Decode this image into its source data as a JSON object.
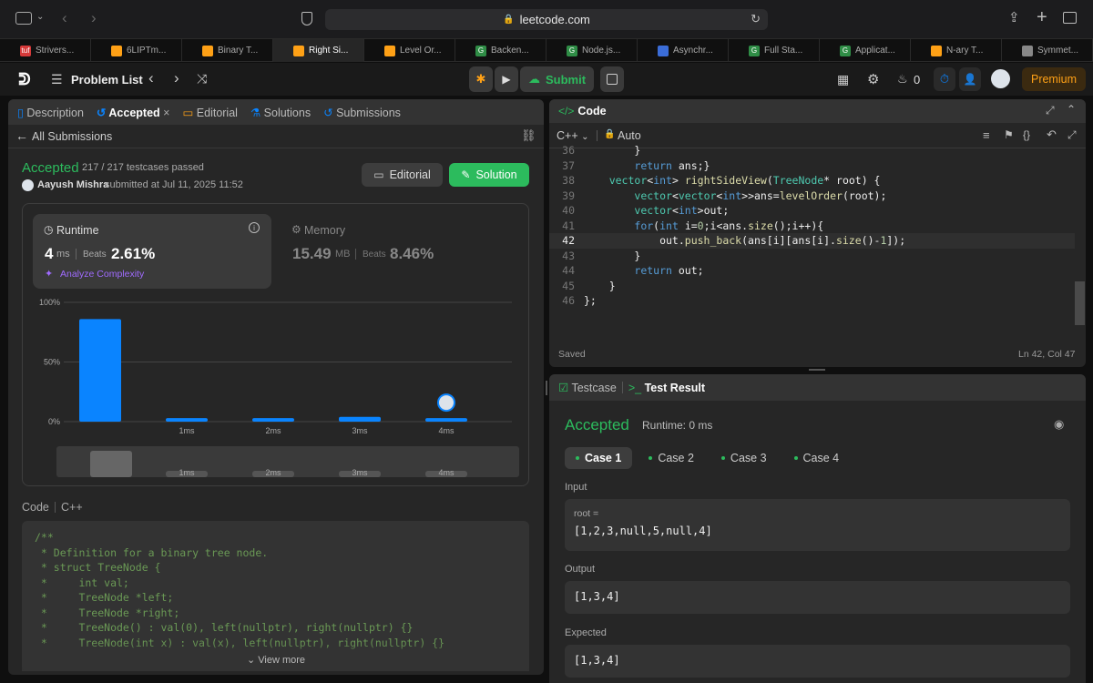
{
  "browser": {
    "url": "leetcode.com",
    "tabs": [
      {
        "label": "Strivers...",
        "fav_color": "#d63a3a",
        "fav_text": "tuf"
      },
      {
        "label": "6LIPTm...",
        "fav_color": "#ffa116",
        "fav_text": ""
      },
      {
        "label": "Binary T...",
        "fav_color": "#ffa116",
        "fav_text": ""
      },
      {
        "label": "Right Si...",
        "fav_color": "#ffa116",
        "fav_text": ""
      },
      {
        "label": "Level Or...",
        "fav_color": "#ffa116",
        "fav_text": ""
      },
      {
        "label": "Backen...",
        "fav_color": "#2f8d46",
        "fav_text": "G"
      },
      {
        "label": "Node.js...",
        "fav_color": "#2f8d46",
        "fav_text": "G"
      },
      {
        "label": "Asynchr...",
        "fav_color": "#3b6dd8",
        "fav_text": ""
      },
      {
        "label": "Full Sta...",
        "fav_color": "#2f8d46",
        "fav_text": "G"
      },
      {
        "label": "Applicat...",
        "fav_color": "#2f8d46",
        "fav_text": "G"
      },
      {
        "label": "N-ary T...",
        "fav_color": "#ffa116",
        "fav_text": ""
      },
      {
        "label": "Symmet...",
        "fav_color": "#888888",
        "fav_text": ""
      }
    ],
    "active_tab_index": 3
  },
  "nav": {
    "problem_list": "Problem List",
    "submit": "Submit",
    "streak": "0",
    "premium": "Premium"
  },
  "left": {
    "tabs": {
      "description": "Description",
      "accepted": "Accepted",
      "editorial": "Editorial",
      "solutions": "Solutions",
      "submissions": "Submissions"
    },
    "all_submissions": "All Submissions",
    "status": "Accepted",
    "testcases": "217 / 217 testcases passed",
    "user": "Aayush Mishra",
    "submitted_at": "submitted at Jul 11, 2025 11:52",
    "editorial_btn": "Editorial",
    "solution_btn": "Solution",
    "runtime": {
      "label": "Runtime",
      "value": "4",
      "unit": "ms",
      "beats_label": "Beats",
      "beats": "2.61%",
      "analyze": "Analyze Complexity"
    },
    "memory": {
      "label": "Memory",
      "value": "15.49",
      "unit": "MB",
      "beats_label": "Beats",
      "beats": "8.46%"
    },
    "code_label": "Code",
    "code_lang": "C++",
    "code_lines": [
      "/**",
      " * Definition for a binary tree node.",
      " * struct TreeNode {",
      " *     int val;",
      " *     TreeNode *left;",
      " *     TreeNode *right;",
      " *     TreeNode() : val(0), left(nullptr), right(nullptr) {}",
      " *     TreeNode(int x) : val(x), left(nullptr), right(nullptr) {}"
    ],
    "view_more": "View more"
  },
  "chart_data": {
    "type": "bar",
    "y_tick_labels": [
      "100%",
      "50%",
      "0%"
    ],
    "categories": [
      "",
      "1ms",
      "2ms",
      "3ms",
      "4ms"
    ],
    "values": [
      86,
      3,
      3,
      4,
      3
    ],
    "ylim": [
      0,
      100
    ],
    "grid": true,
    "bar_color": "#0a84ff",
    "highlight_category": "4ms",
    "navigator_labels": [
      "1ms",
      "2ms",
      "3ms",
      "4ms"
    ]
  },
  "editor": {
    "title": "Code",
    "lang": "C++",
    "mode": "Auto",
    "saved": "Saved",
    "cursor": "Ln 42, Col 47",
    "current_line": 42
  },
  "result": {
    "tabs": {
      "testcase": "Testcase",
      "test_result": "Test Result"
    },
    "status": "Accepted",
    "runtime": "Runtime: 0 ms",
    "cases": [
      "Case 1",
      "Case 2",
      "Case 3",
      "Case 4"
    ],
    "input_label": "Input",
    "input_var": "root =",
    "input_value": "[1,2,3,null,5,null,4]",
    "output_label": "Output",
    "output_value": "[1,3,4]",
    "expected_label": "Expected",
    "expected_value": "[1,3,4]"
  },
  "colors": {
    "accepted": "#2cbb5d",
    "accent_blue": "#0a84ff",
    "premium": "#ffa116"
  }
}
